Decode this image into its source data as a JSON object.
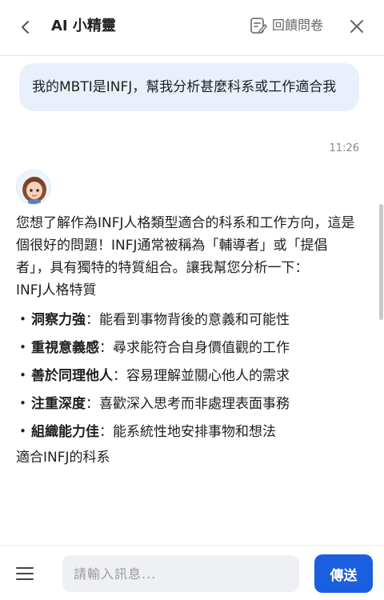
{
  "header": {
    "title": "AI 小精靈",
    "feedback_label": "回饋問卷"
  },
  "chat": {
    "user_message": "我的MBTI是INFJ，幫我分析甚麼科系或工作適合我",
    "timestamp": "11:26",
    "bot_intro": "您想了解作為INFJ人格類型適合的科系和工作方向，這是個很好的問題！INFJ通常被稱為「輔導者」或「提倡者」，具有獨特的特質組合。讓我幫您分析一下：",
    "section_title": "INFJ人格特質",
    "traits": [
      {
        "bullet": "・",
        "name": "洞察力強",
        "desc": "：能看到事物背後的意義和可能性"
      },
      {
        "bullet": "・",
        "name": "重視意義感",
        "desc": "：尋求能符合自身價值觀的工作"
      },
      {
        "bullet": "・",
        "name": "善於同理他人",
        "desc": "：容易理解並關心他人的需求"
      },
      {
        "bullet": "・",
        "name": "注重深度",
        "desc": "：喜歡深入思考而非處理表面事務"
      },
      {
        "bullet": "・",
        "name": "組織能力佳",
        "desc": "：能系統性地安排事物和想法"
      }
    ],
    "section2_title": "適合INFJ的科系"
  },
  "footer": {
    "input_placeholder": "請輸入訊息...",
    "send_label": "傳送"
  },
  "colors": {
    "accent": "#1a5fe0",
    "user_bubble": "#e9f0fc",
    "input_bg": "#eff0f3"
  },
  "icons": {
    "back": "chevron-left-icon",
    "feedback": "edit-form-icon",
    "close": "close-icon",
    "menu": "menu-icon",
    "avatar": "avatar"
  }
}
